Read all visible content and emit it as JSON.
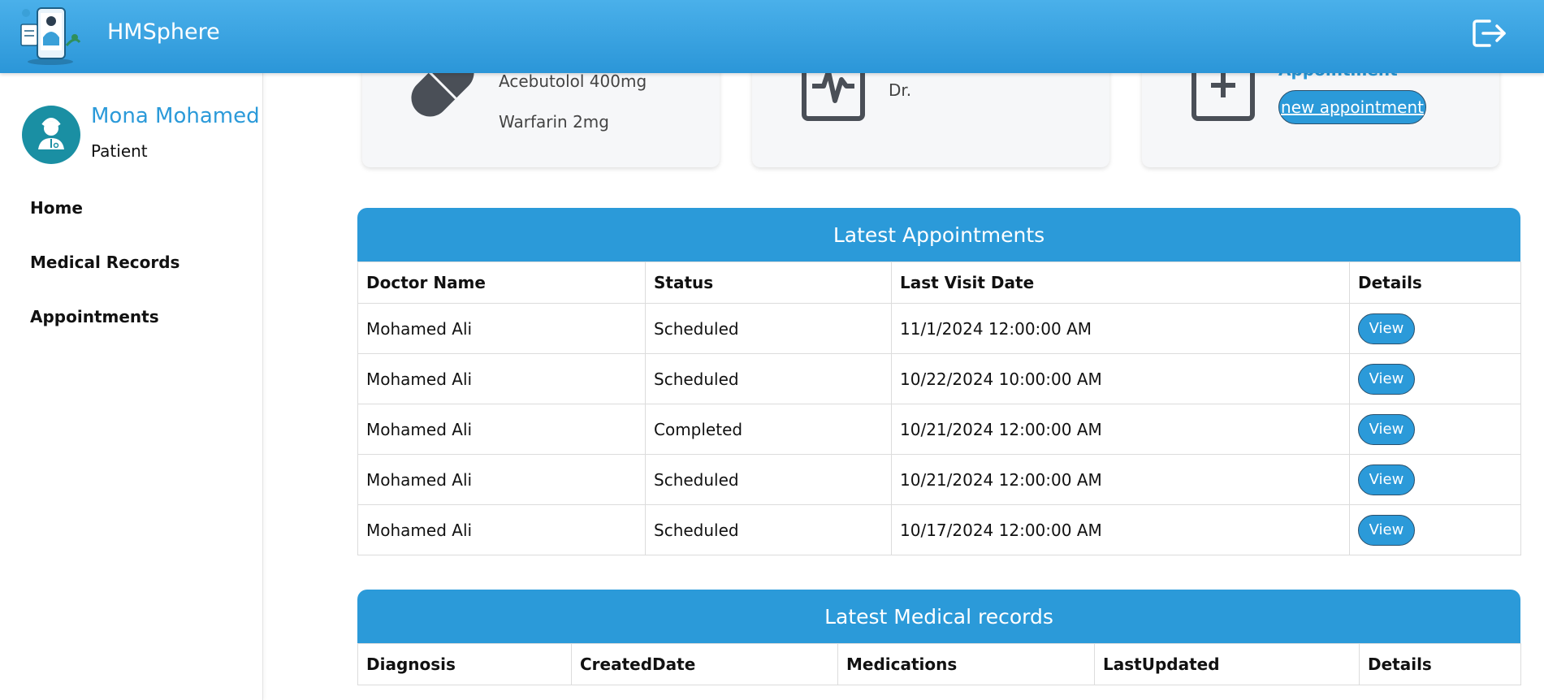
{
  "header": {
    "app_title": "HMSphere",
    "logout_icon": "logout-icon"
  },
  "user": {
    "name": "Mona Mohamed",
    "role": "Patient"
  },
  "nav": [
    {
      "label": "Home"
    },
    {
      "label": "Medical Records"
    },
    {
      "label": "Appointments"
    }
  ],
  "cards": {
    "medications": {
      "icon": "pill-icon",
      "items": [
        "Acebutolol 400mg",
        "Warfarin 2mg"
      ]
    },
    "doctor": {
      "icon": "heartbeat-clipboard-icon",
      "text": "Dr."
    },
    "appointment": {
      "icon": "add-clipboard-icon",
      "heading": "Appointment",
      "button_label": "new appointment"
    }
  },
  "appointments": {
    "title": "Latest Appointments",
    "columns": [
      "Doctor Name",
      "Status",
      "Last Visit Date",
      "Details"
    ],
    "rows": [
      {
        "doctor": "Mohamed Ali",
        "status": "Scheduled",
        "date": "11/1/2024 12:00:00 AM",
        "action": "View"
      },
      {
        "doctor": "Mohamed Ali",
        "status": "Scheduled",
        "date": "10/22/2024 10:00:00 AM",
        "action": "View"
      },
      {
        "doctor": "Mohamed Ali",
        "status": "Completed",
        "date": "10/21/2024 12:00:00 AM",
        "action": "View"
      },
      {
        "doctor": "Mohamed Ali",
        "status": "Scheduled",
        "date": "10/21/2024 12:00:00 AM",
        "action": "View"
      },
      {
        "doctor": "Mohamed Ali",
        "status": "Scheduled",
        "date": "10/17/2024 12:00:00 AM",
        "action": "View"
      }
    ]
  },
  "medical_records": {
    "title": "Latest Medical records",
    "columns": [
      "Diagnosis",
      "CreatedDate",
      "Medications",
      "LastUpdated",
      "Details"
    ]
  },
  "colors": {
    "primary": "#2b9ad9",
    "header_top": "#4ab0ea",
    "card_bg": "#f6f7f9",
    "icon_dark": "#4a4f57"
  }
}
